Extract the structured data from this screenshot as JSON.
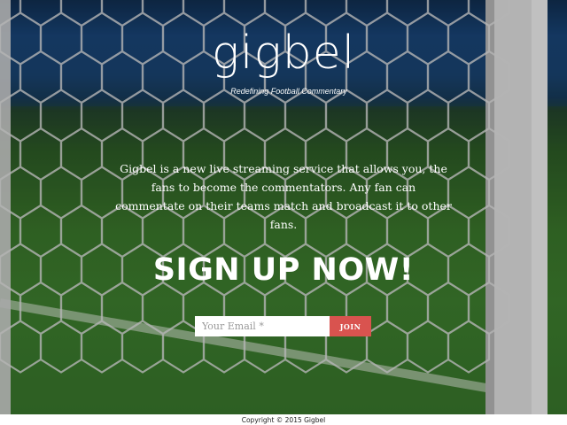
{
  "brand": {
    "logo": "gigbel",
    "tagline": "Redefining Football Commentary"
  },
  "intro": {
    "text": "Gigbel is a new live streaming service that allows you, the fans to become the commentators. Any fan can commentate on their teams match and broadcast it to other fans."
  },
  "cta": {
    "heading": "SIGN UP NOW!"
  },
  "signup_form": {
    "email_placeholder": "Your Email *",
    "email_value": "",
    "join_label": "JOIN"
  },
  "footer": {
    "copyright": "Copyright © 2015 Gigbel"
  },
  "colors": {
    "join_button": "#d9534f",
    "text": "#ffffff",
    "footer_background": "#ffffff"
  }
}
